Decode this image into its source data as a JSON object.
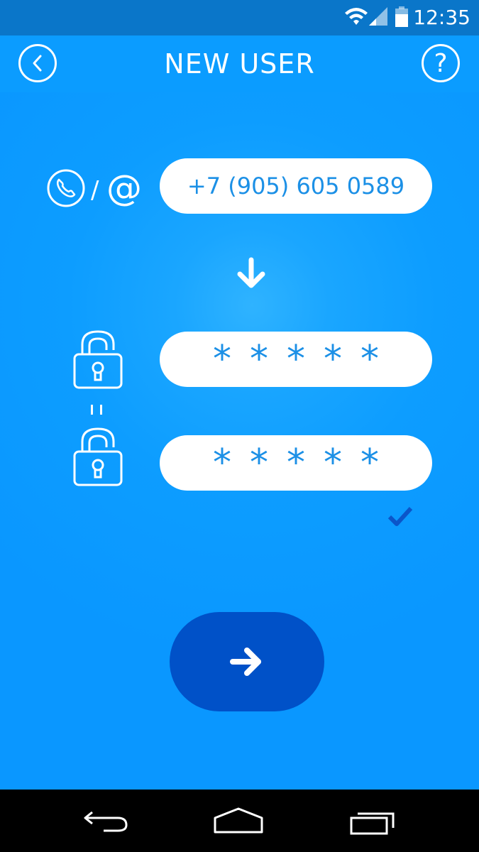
{
  "status_bar": {
    "time": "12:35",
    "icons": [
      "wifi-icon",
      "signal-icon",
      "battery-icon"
    ]
  },
  "header": {
    "title": "NEW USER",
    "back_icon": "chevron-left-icon",
    "help_label": "?"
  },
  "form": {
    "contact_icons": [
      "phone-icon",
      "at-sign-icon"
    ],
    "contact_separator": "/",
    "login_value": "+7 (905) 605 0589",
    "password_value": "*****",
    "password_confirm_value": "*****",
    "equals_sign": "=",
    "match_icon": "checkmark-icon"
  },
  "actions": {
    "next_icon": "arrow-right-icon"
  },
  "navigation_bar": {
    "icons": [
      "back-nav-icon",
      "home-nav-icon",
      "recent-apps-icon"
    ]
  },
  "colors": {
    "background": "#0a97ff",
    "status_bar": "#0a76c9",
    "button": "#0051c8",
    "field_text": "#1c90e6",
    "check": "#0b55c9"
  }
}
